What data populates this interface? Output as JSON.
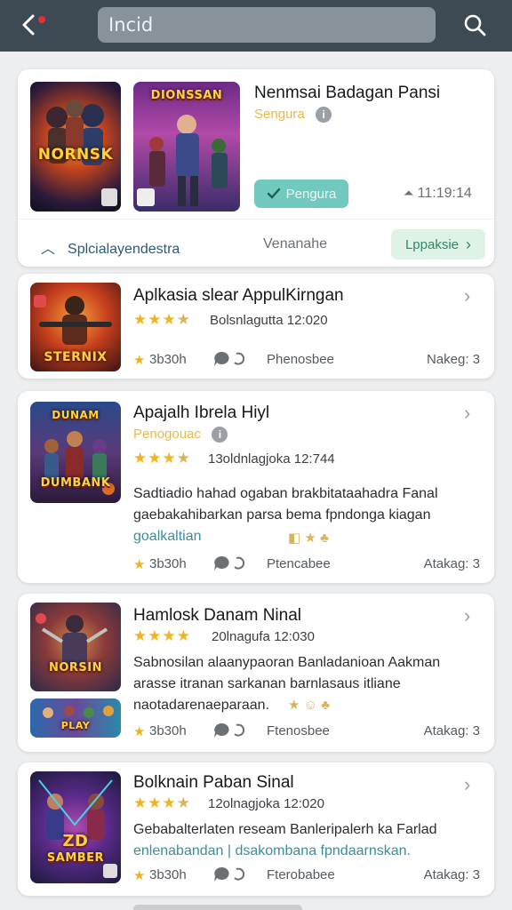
{
  "header": {
    "search_text": "Incid"
  },
  "featured": {
    "title": "Nenmsai Badagan Pansi",
    "subtitle": "Sengura",
    "thumb1_text": "NORNSK",
    "thumb2_text": "DIONSSAN",
    "install_label": "Pengura",
    "time": "11:19:14",
    "tabs": {
      "left": "Splcialayendestra",
      "middle": "Venanahe",
      "right": "Lppaksie"
    }
  },
  "apps": [
    {
      "title": "Aplkasia slear AppulKirngan",
      "rating": 3.5,
      "date": "Bolsnlagutta 12:020",
      "thumb_text": "STERNIX",
      "footer": {
        "stars": "3b30h",
        "middle": "Phenosbee",
        "right": "Nakeg: 3"
      }
    },
    {
      "title": "Apajalh Ibrela Hiyl",
      "subtitle": "Penogouac",
      "rating": 3.5,
      "date": "13oldnlagjoka 12:744",
      "thumb_text": "DUMBANK",
      "description_lines": [
        "Sadtiadio hahad ogaban brakbitataahadra Fanal",
        "gaebakahibarkan parsa bema fpndonga kiagan",
        "goalkaltian"
      ],
      "footer": {
        "stars": "3b30h",
        "middle": "Ptencabee",
        "right": "Atakag: 3"
      }
    },
    {
      "title": "Hamlosk Danam Ninal",
      "rating": 4,
      "date": "20lnagufa 12:030",
      "thumb_text": "NORSIN",
      "description_lines": [
        "Sabnosilan alaanypaoran Banladanioan Aakman",
        "arasse itranan sarkanan barnlasaus itliane",
        "naotadarenaeparaan."
      ],
      "footer": {
        "stars": "3b30h",
        "middle": "Ftenosbee",
        "right": "Atakag: 3"
      }
    },
    {
      "title": "Bolknain Paban Sinal",
      "rating": 3.5,
      "date": "12olnagjoka 12:020",
      "thumb_text": "SAMBER",
      "description_lines": [
        "Gebabalterlaten reseam Banleripalerh ka Farlad",
        "enlenabandan | dsakombana fpndaarnskan."
      ],
      "footer": {
        "stars": "3b30h",
        "middle": "Fterobabee",
        "right": "Atakag: 3"
      }
    }
  ],
  "colors": {
    "topbar": "#3d4a54",
    "accent_teal": "#72c9bd",
    "star": "#f2b31c",
    "badge_red": "#e0313a"
  }
}
